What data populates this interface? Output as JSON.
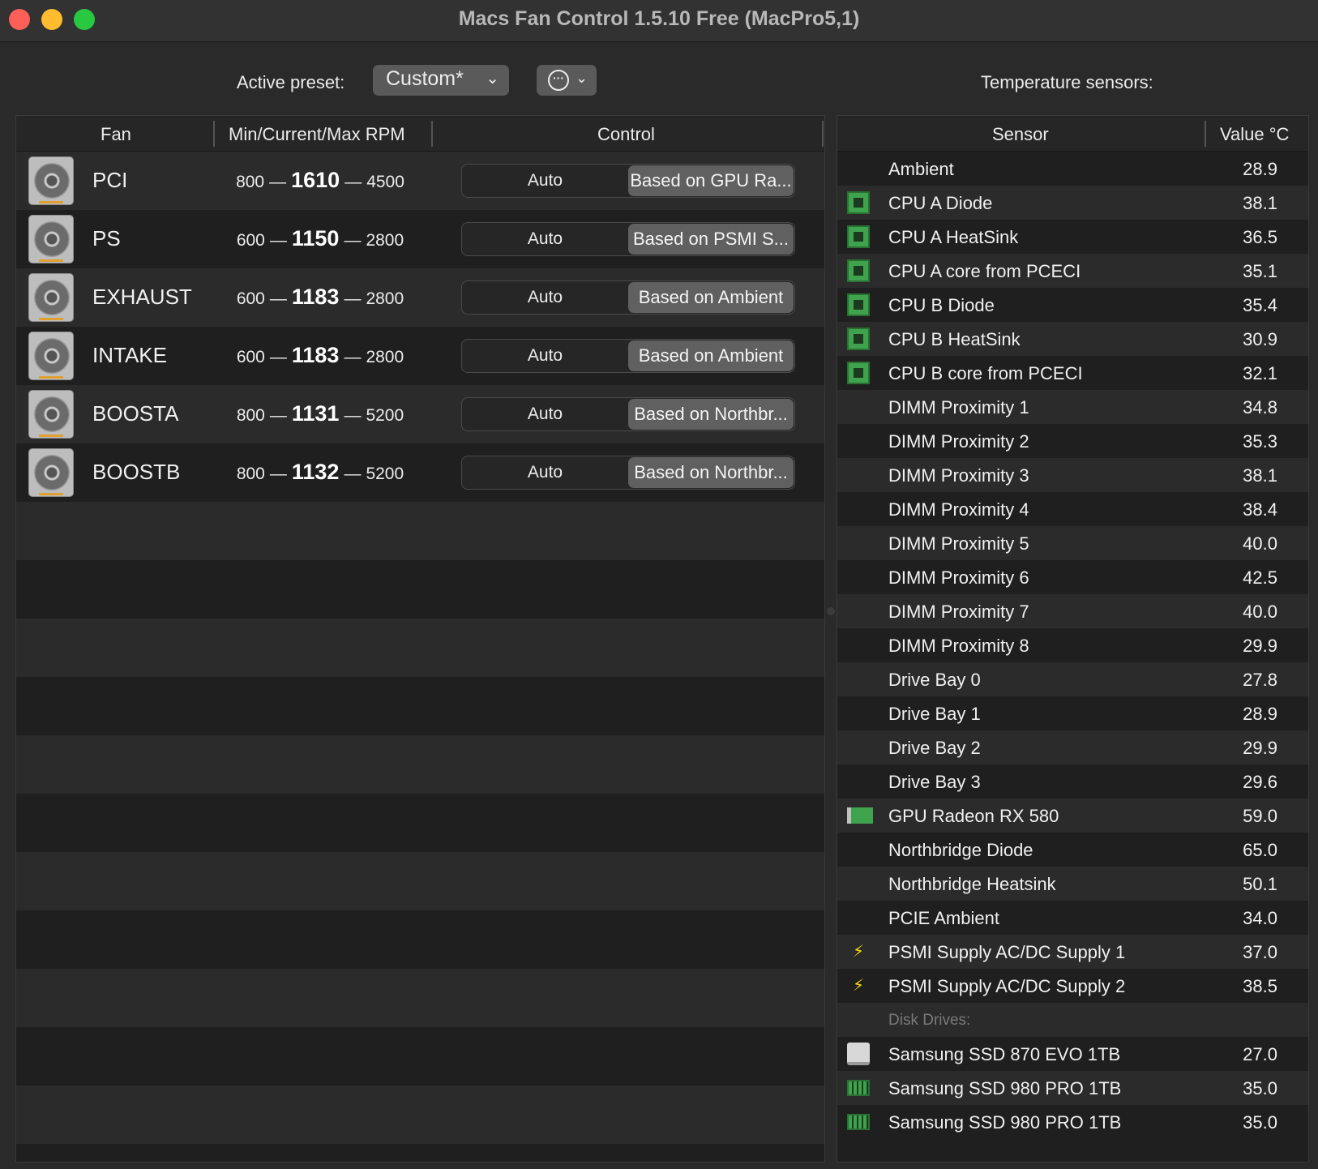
{
  "window": {
    "title": "Macs Fan Control 1.5.10 Free (MacPro5,1)"
  },
  "toolbar": {
    "preset_label": "Active preset:",
    "preset_value": "Custom*",
    "temp_label": "Temperature sensors:"
  },
  "fan_table": {
    "headers": {
      "fan": "Fan",
      "rpm": "Min/Current/Max RPM",
      "control": "Control"
    },
    "rows": [
      {
        "name": "PCI",
        "min": "800",
        "current": "1610",
        "max": "4500",
        "auto": "Auto",
        "based": "Based on GPU Ra..."
      },
      {
        "name": "PS",
        "min": "600",
        "current": "1150",
        "max": "2800",
        "auto": "Auto",
        "based": "Based on PSMI S..."
      },
      {
        "name": "EXHAUST",
        "min": "600",
        "current": "1183",
        "max": "2800",
        "auto": "Auto",
        "based": "Based on Ambient"
      },
      {
        "name": "INTAKE",
        "min": "600",
        "current": "1183",
        "max": "2800",
        "auto": "Auto",
        "based": "Based on Ambient"
      },
      {
        "name": "BOOSTA",
        "min": "800",
        "current": "1131",
        "max": "5200",
        "auto": "Auto",
        "based": "Based on Northbr..."
      },
      {
        "name": "BOOSTB",
        "min": "800",
        "current": "1132",
        "max": "5200",
        "auto": "Auto",
        "based": "Based on Northbr..."
      }
    ],
    "dash": "—"
  },
  "sensor_table": {
    "headers": {
      "sensor": "Sensor",
      "value": "Value °C"
    },
    "rows": [
      {
        "icon": "none",
        "name": "Ambient",
        "value": "28.9"
      },
      {
        "icon": "cpu-chip-icon",
        "name": "CPU A Diode",
        "value": "38.1"
      },
      {
        "icon": "cpu-chip-icon",
        "name": "CPU A HeatSink",
        "value": "36.5"
      },
      {
        "icon": "cpu-chip-icon",
        "name": "CPU A core from PCECI",
        "value": "35.1"
      },
      {
        "icon": "cpu-chip-icon",
        "name": "CPU B Diode",
        "value": "35.4"
      },
      {
        "icon": "cpu-chip-icon",
        "name": "CPU B HeatSink",
        "value": "30.9"
      },
      {
        "icon": "cpu-chip-icon",
        "name": "CPU B core from PCECI",
        "value": "32.1"
      },
      {
        "icon": "none",
        "name": "DIMM Proximity 1",
        "value": "34.8"
      },
      {
        "icon": "none",
        "name": "DIMM Proximity 2",
        "value": "35.3"
      },
      {
        "icon": "none",
        "name": "DIMM Proximity 3",
        "value": "38.1"
      },
      {
        "icon": "none",
        "name": "DIMM Proximity 4",
        "value": "38.4"
      },
      {
        "icon": "none",
        "name": "DIMM Proximity 5",
        "value": "40.0"
      },
      {
        "icon": "none",
        "name": "DIMM Proximity 6",
        "value": "42.5"
      },
      {
        "icon": "none",
        "name": "DIMM Proximity 7",
        "value": "40.0"
      },
      {
        "icon": "none",
        "name": "DIMM Proximity 8",
        "value": "29.9"
      },
      {
        "icon": "none",
        "name": "Drive Bay 0",
        "value": "27.8"
      },
      {
        "icon": "none",
        "name": "Drive Bay 1",
        "value": "28.9"
      },
      {
        "icon": "none",
        "name": "Drive Bay 2",
        "value": "29.9"
      },
      {
        "icon": "none",
        "name": "Drive Bay 3",
        "value": "29.6"
      },
      {
        "icon": "gpu-card-icon",
        "name": "GPU Radeon RX 580",
        "value": "59.0"
      },
      {
        "icon": "none",
        "name": "Northbridge Diode",
        "value": "65.0"
      },
      {
        "icon": "none",
        "name": "Northbridge Heatsink",
        "value": "50.1"
      },
      {
        "icon": "none",
        "name": "PCIE Ambient",
        "value": "34.0"
      },
      {
        "icon": "power-bolt-icon",
        "name": "PSMI Supply AC/DC Supply 1",
        "value": "37.0"
      },
      {
        "icon": "power-bolt-icon",
        "name": "PSMI Supply AC/DC Supply 2",
        "value": "38.5"
      }
    ],
    "disk_section_label": "Disk Drives:",
    "disks": [
      {
        "icon": "sata-disk-icon",
        "name": "Samsung SSD 870 EVO 1TB",
        "value": "27.0"
      },
      {
        "icon": "nvme-ssd-icon",
        "name": "Samsung SSD 980 PRO 1TB",
        "value": "35.0"
      },
      {
        "icon": "nvme-ssd-icon",
        "name": "Samsung SSD 980 PRO 1TB",
        "value": "35.0"
      }
    ]
  }
}
